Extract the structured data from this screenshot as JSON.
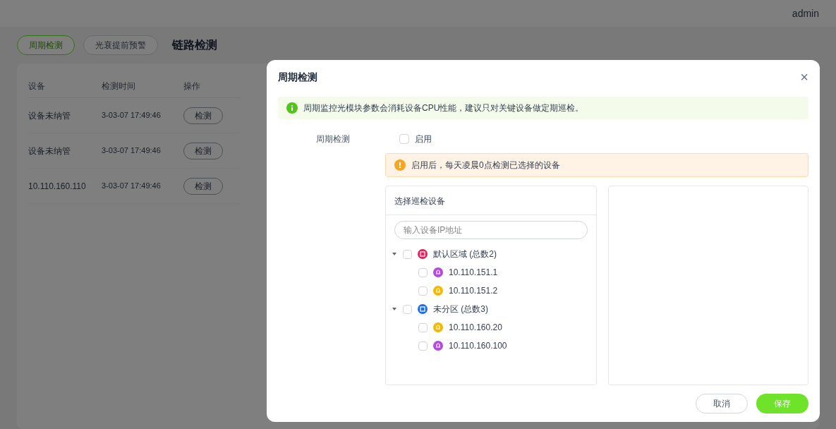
{
  "top_bar": {
    "user": "admin"
  },
  "page_tabs": [
    {
      "label": "周期检测",
      "selected": true
    },
    {
      "label": "光衰提前预警",
      "selected": false
    }
  ],
  "page_title": "链路检测",
  "background_table": {
    "columns": [
      "设备",
      "检测时间",
      "操作"
    ],
    "rows": [
      {
        "device": "设备未纳管",
        "time": "3-03-07 17:49:46",
        "action": "检测"
      },
      {
        "device": "设备未纳管",
        "time": "3-03-07 17:49:46",
        "action": "检测"
      },
      {
        "device": "10.110.160.110",
        "time": "3-03-07 17:49:46",
        "action": "检测"
      }
    ]
  },
  "dialog": {
    "title": "周期检测",
    "close": "×",
    "info": "周期监控光模块参数会消耗设备CPU性能，建议只对关键设备做定期巡检。",
    "form_label": "周期检测",
    "enable": {
      "label": "启用",
      "checked": false
    },
    "warning": "启用后，每天凌晨0点检测已选择的设备",
    "transfer": {
      "title": "选择巡检设备",
      "search": {
        "placeholder": "输入设备IP地址"
      },
      "tree": [
        {
          "label": "默认区域 (总数2)",
          "kind": "region",
          "color": "#e0245e",
          "expanded": true,
          "checked": false,
          "children": [
            {
              "label": "10.110.151.1",
              "kind": "device",
              "color": "#b44ae0",
              "checked": false
            },
            {
              "label": "10.110.151.2",
              "kind": "device",
              "color": "#f5b800",
              "checked": false
            }
          ]
        },
        {
          "label": "未分区 (总数3)",
          "kind": "region",
          "color": "#1f6fe0",
          "expanded": true,
          "checked": false,
          "children": [
            {
              "label": "10.110.160.20",
              "kind": "device",
              "color": "#f5b800",
              "checked": false
            },
            {
              "label": "10.110.160.100",
              "kind": "device",
              "color": "#b44ae0",
              "checked": false
            }
          ]
        }
      ]
    },
    "buttons": {
      "cancel": "取消",
      "save": "保存"
    }
  }
}
